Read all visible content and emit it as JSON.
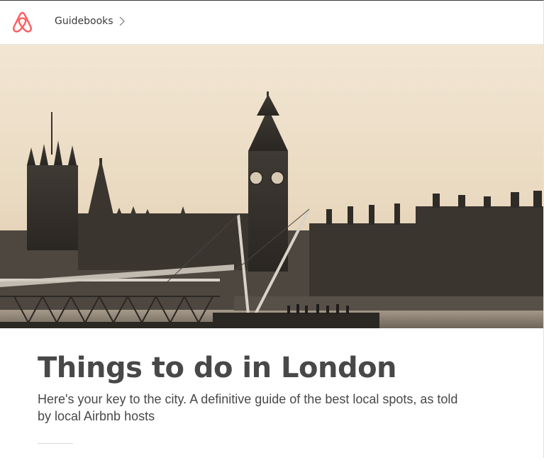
{
  "header": {
    "logo_icon": "airbnb-logo-icon",
    "breadcrumb_label": "Guidebooks",
    "breadcrumb_icon": "chevron-right-icon"
  },
  "hero": {
    "image": "london-skyline-big-ben-westminster-photo"
  },
  "main": {
    "title": "Things to do in London",
    "subtitle": "Here's your key to the city. A definitive guide of the best local spots, as told by local Airbnb hosts"
  },
  "colors": {
    "brand": "#FF5A5F",
    "text": "#484848",
    "divider": "#D8D8D8"
  }
}
